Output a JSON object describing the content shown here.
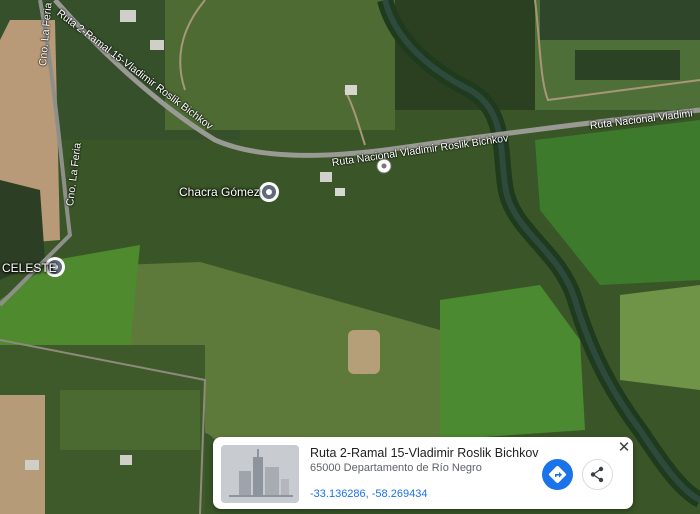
{
  "map": {
    "places": {
      "chacra": "Chacra Gómez",
      "celeste": "CELESTE"
    },
    "roads": {
      "ruta2_top": "Ruta 2-Ramal 15-Vladimir Roslik Bichkov",
      "ruta_mid": "Ruta Nacional Vladimir Roslik Bichkov",
      "ruta_right": "Ruta Nacional Vladimi",
      "cno_top": "Cno. La Feria",
      "cno_bottom": "Cno. La Feria"
    }
  },
  "card": {
    "title": "Ruta 2-Ramal 15-Vladimir Roslik Bichkov",
    "address": "65000 Departamento de Río Negro",
    "coords": "-33.136286, -58.269434",
    "close_label": "✕",
    "icons": {
      "directions": "directions-icon",
      "share": "share-icon",
      "close": "close-icon",
      "thumbnail": "building-placeholder-icon"
    }
  }
}
